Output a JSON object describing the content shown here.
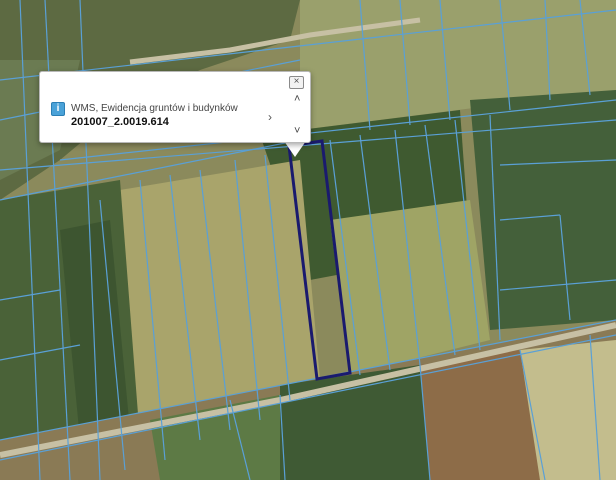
{
  "popup": {
    "layer_name": "WMS, Ewidencja gruntów i budynków",
    "parcel_id": "201007_2.0019.614",
    "close_glyph": "×",
    "info_glyph": "i",
    "next_glyph": "›",
    "up_glyph": "˄",
    "down_glyph": "˅"
  },
  "map": {
    "colors": {
      "parcel_line": "#5aa0d6",
      "selected_parcel": "#1a1a6e",
      "road": "#b9b39a",
      "field_light": "#a9a86a",
      "field_dark": "#7d7a4a",
      "forest": "#3f5e33"
    }
  }
}
